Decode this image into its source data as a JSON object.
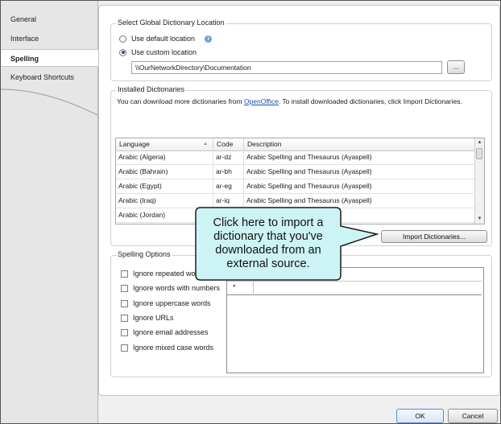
{
  "nav": {
    "items": [
      {
        "label": "General"
      },
      {
        "label": "Interface"
      },
      {
        "label": "Spelling"
      },
      {
        "label": "Keyboard Shortcuts"
      }
    ]
  },
  "location": {
    "group_title": "Select Global Dictionary Location",
    "default_option": "Use default location",
    "custom_option": "Use custom location",
    "path_value": "\\\\OurNetworkDirectory\\Documentation",
    "browse_label": "..."
  },
  "installed": {
    "group_title": "Installed Dictionaries",
    "info_prefix": "You can download more dictionaries from ",
    "info_link": "OpenOffice",
    "info_suffix": ". To install downloaded dictionaries, click Import Dictionaries.",
    "columns": {
      "language": "Language",
      "code": "Code",
      "description": "Description"
    },
    "rows": [
      {
        "language": "Arabic (Algeria)",
        "code": "ar-dz",
        "description": "Arabic Spelling and Thesaurus (Ayaspell)"
      },
      {
        "language": "Arabic (Bahrain)",
        "code": "ar-bh",
        "description": "Arabic Spelling and Thesaurus (Ayaspell)"
      },
      {
        "language": "Arabic (Egypt)",
        "code": "ar-eg",
        "description": "Arabic Spelling and Thesaurus (Ayaspell)"
      },
      {
        "language": "Arabic (Iraq)",
        "code": "ar-iq",
        "description": "Arabic Spelling and Thesaurus (Ayaspell)"
      },
      {
        "language": "Arabic (Jordan)",
        "code": "",
        "description": "(Ayaspell)"
      }
    ],
    "import_label": "Import Dictionaries..."
  },
  "options": {
    "group_title": "Spelling Options",
    "checks": [
      {
        "label": "Ignore repeated wor"
      },
      {
        "label": "Ignore words with numbers"
      },
      {
        "label": "Ignore uppercase words"
      },
      {
        "label": "Ignore URLs"
      },
      {
        "label": "Ignore email addresses"
      },
      {
        "label": "Ignore mixed case words"
      }
    ],
    "grid_new_row_marker": "*"
  },
  "callout": {
    "text": "Click here to import a dictionary that you've downloaded from an external source.",
    "fill": "#cdf4f5",
    "stroke": "#1a1a1a"
  },
  "footer": {
    "ok_label": "OK",
    "cancel_label": "Cancel"
  }
}
